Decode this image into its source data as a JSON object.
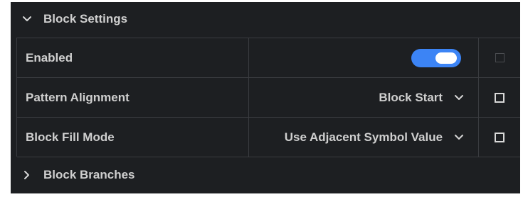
{
  "sections": {
    "block_settings": {
      "label": "Block Settings",
      "expanded": true,
      "icon": "chevron-down-icon"
    },
    "block_branches": {
      "label": "Block Branches",
      "expanded": false,
      "icon": "chevron-right-icon"
    }
  },
  "rows": [
    {
      "label": "Enabled",
      "control": "toggle",
      "toggle_on": true,
      "checkbox_checked": false,
      "checkbox_disabled": true
    },
    {
      "label": "Pattern Alignment",
      "control": "dropdown",
      "value": "Block Start",
      "checkbox_checked": false
    },
    {
      "label": "Block Fill Mode",
      "control": "dropdown",
      "value": "Use Adjacent Symbol Value",
      "checkbox_checked": false
    }
  ],
  "colors": {
    "panel_bg": "#1d1f22",
    "grid_line": "#3a3c40",
    "text": "#cfcfcf",
    "toggle_accent": "#3c84f5"
  }
}
